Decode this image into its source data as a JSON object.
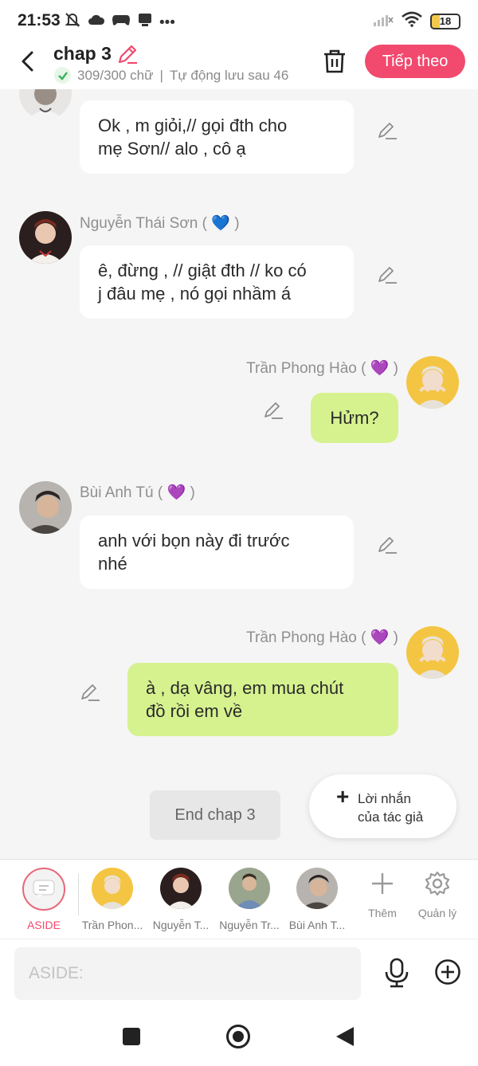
{
  "status_bar": {
    "time": "21:53",
    "battery": "18",
    "more": "•••"
  },
  "header": {
    "title": "chap 3",
    "word_count": "309/300 chữ",
    "separator": "|",
    "autosave": "Tự động lưu sau 46",
    "next_button": "Tiếp theo"
  },
  "messages": [
    {
      "sender": "",
      "heart": "",
      "side": "left",
      "text_lines": [
        "Ok , m giỏi,// gọi đth cho",
        "mẹ Sơn// alo , cô ạ"
      ]
    },
    {
      "sender": "Nguyễn Thái Sơn (",
      "sender_end": ")",
      "heart": "💙",
      "side": "left",
      "text_lines": [
        "ê, đừng , // giật đth // ko có",
        "j đâu mẹ , nó gọi nhầm á"
      ]
    },
    {
      "sender": "Trần Phong Hào (",
      "sender_end": ")",
      "heart": "💜",
      "side": "right",
      "text_lines": [
        "Hửm?"
      ]
    },
    {
      "sender": "Bùi Anh Tú (",
      "sender_end": ")",
      "heart": "💜",
      "side": "left",
      "text_lines": [
        "anh  với bọn này đi trước",
        "nhé"
      ]
    },
    {
      "sender": "Trần Phong Hào (",
      "sender_end": ")",
      "heart": "💜",
      "side": "right",
      "text_lines": [
        "à , dạ vâng, em mua chút",
        "đồ rồi em về"
      ]
    }
  ],
  "end_chap": "End chap 3",
  "author_note": {
    "line1": "Lời nhắn",
    "line2": "của tác giả"
  },
  "characters": {
    "aside": "ASIDE",
    "list": [
      "Trần Phon...",
      "Nguyễn T...",
      "Nguyễn Tr...",
      "Bùi Anh T..."
    ],
    "add_label": "Thêm",
    "manage_label": "Quản lý"
  },
  "input": {
    "placeholder": "ASIDE:"
  },
  "colors": {
    "accent": "#f2496e",
    "green_bubble": "#d6f28f",
    "background": "#f5f5f5"
  }
}
